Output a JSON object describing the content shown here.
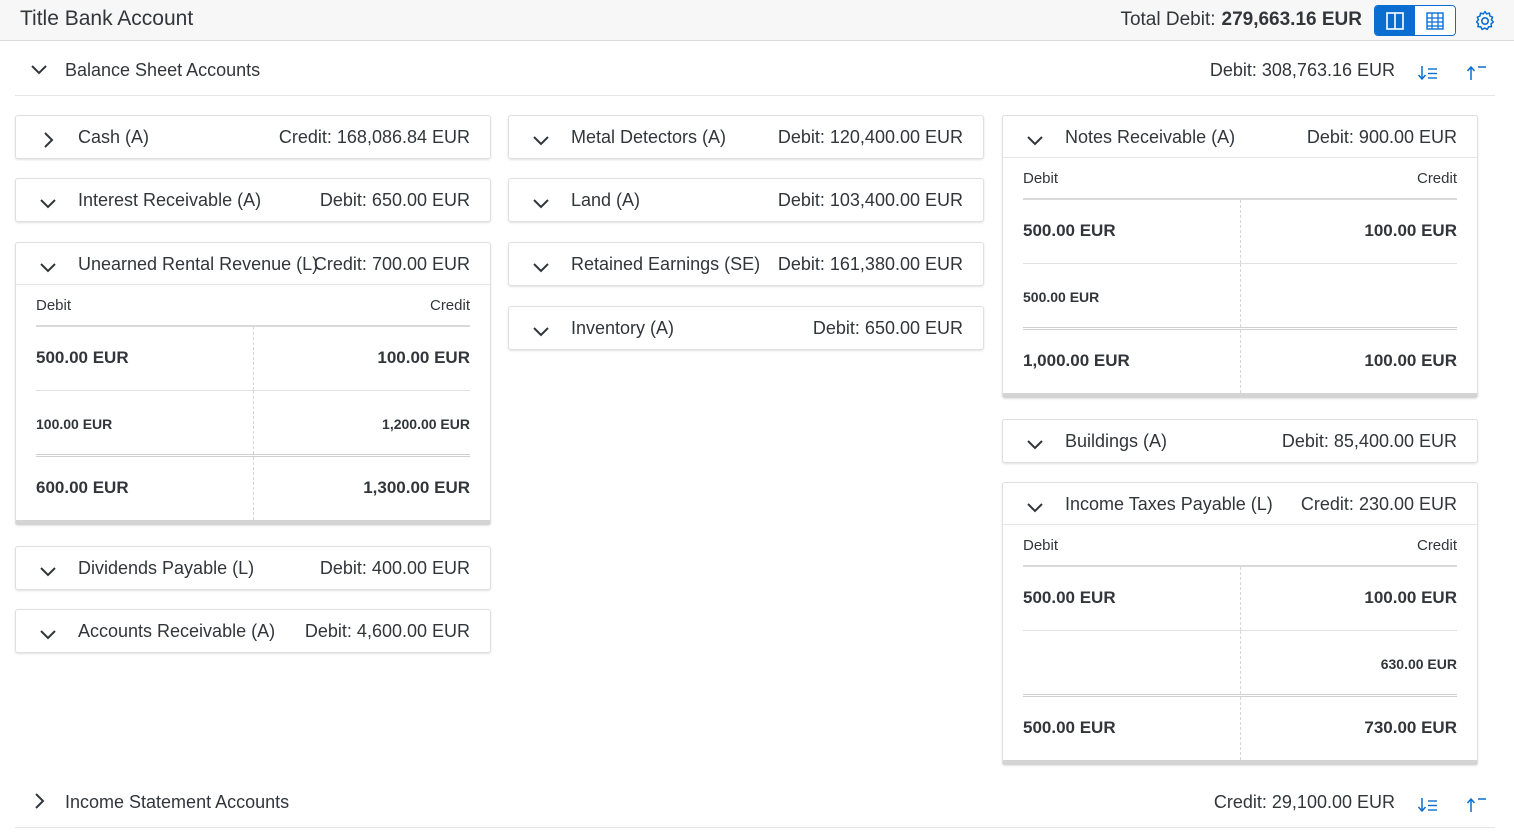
{
  "header": {
    "title": "Title Bank Account",
    "total_label": "Total Debit:",
    "total_value": "279,663.16 EUR",
    "view_toggle": [
      "column-view-icon",
      "grid-view-icon"
    ],
    "settings_icon": "gear-icon"
  },
  "balance_section": {
    "label": "Balance Sheet Accounts",
    "sum": "Debit: 308,763.16 EUR"
  },
  "income_section": {
    "label": "Income Statement Accounts",
    "sum": "Credit: 29,100.00 EUR"
  },
  "columns": {
    "debit": "Debit",
    "credit": "Credit"
  },
  "accounts": {
    "cash": {
      "name": "Cash (A)",
      "balance": "Credit: 168,086.84 EUR"
    },
    "interest_receivable": {
      "name": "Interest Receivable (A)",
      "balance": "Debit: 650.00 EUR"
    },
    "unearned_rental": {
      "name": "Unearned Rental Revenue (L)",
      "balance": "Credit: 700.00 EUR",
      "rows": [
        {
          "debit": "500.00 EUR",
          "credit": "100.00 EUR"
        },
        {
          "debit": "100.00 EUR",
          "credit": "1,200.00 EUR"
        }
      ],
      "total": {
        "debit": "600.00 EUR",
        "credit": "1,300.00 EUR"
      }
    },
    "dividends_payable": {
      "name": "Dividends Payable (L)",
      "balance": "Debit: 400.00 EUR"
    },
    "accounts_receivable": {
      "name": "Accounts Receivable (A)",
      "balance": "Debit: 4,600.00 EUR"
    },
    "metal_detectors": {
      "name": "Metal Detectors (A)",
      "balance": "Debit: 120,400.00 EUR"
    },
    "land": {
      "name": "Land (A)",
      "balance": "Debit: 103,400.00 EUR"
    },
    "retained_earnings": {
      "name": "Retained Earnings (SE)",
      "balance": "Debit: 161,380.00 EUR"
    },
    "inventory": {
      "name": "Inventory (A)",
      "balance": "Debit: 650.00 EUR"
    },
    "notes_receivable": {
      "name": "Notes Receivable (A)",
      "balance": "Debit: 900.00 EUR",
      "rows": [
        {
          "debit": "500.00 EUR",
          "credit": "100.00 EUR"
        },
        {
          "debit": "500.00 EUR",
          "credit": ""
        }
      ],
      "total": {
        "debit": "1,000.00 EUR",
        "credit": "100.00 EUR"
      }
    },
    "buildings": {
      "name": "Buildings (A)",
      "balance": "Debit: 85,400.00 EUR"
    },
    "income_taxes_payable": {
      "name": "Income Taxes Payable (L)",
      "balance": "Credit: 230.00 EUR",
      "rows": [
        {
          "debit": "500.00 EUR",
          "credit": "100.00 EUR"
        },
        {
          "debit": "",
          "credit": "630.00 EUR"
        }
      ],
      "total": {
        "debit": "500.00 EUR",
        "credit": "730.00 EUR"
      }
    }
  }
}
